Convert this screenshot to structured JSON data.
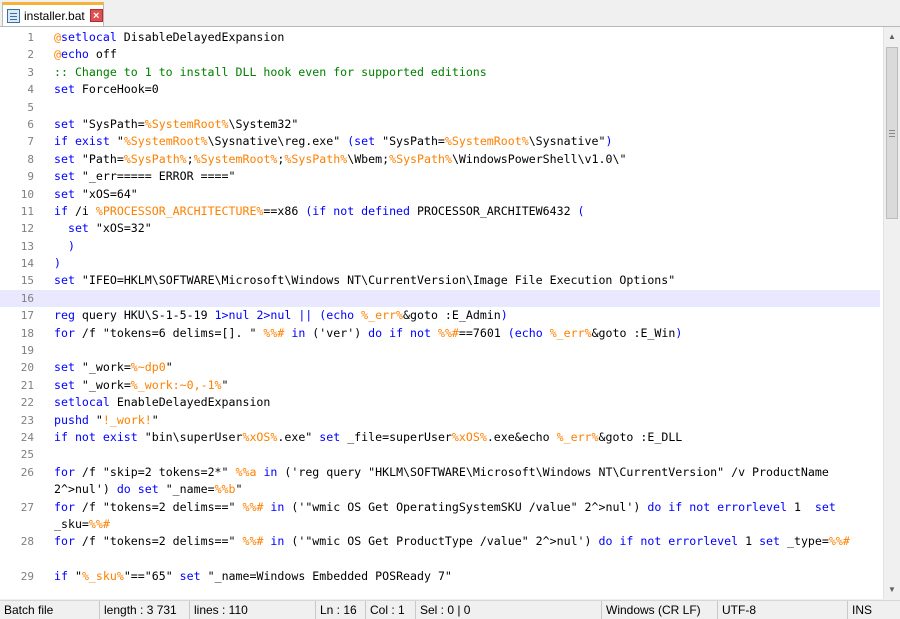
{
  "tab": {
    "title": "installer.bat"
  },
  "editor": {
    "current_line": 16,
    "lines": [
      {
        "n": "1",
        "html": "<span class=\"o\">@</span><span class=\"k\">setlocal</span> DisableDelayedExpansion"
      },
      {
        "n": "2",
        "html": "<span class=\"o\">@</span><span class=\"k\">echo</span> off"
      },
      {
        "n": "3",
        "html": "<span class=\"c\">:: Change to 1 to install DLL hook even for supported editions</span>"
      },
      {
        "n": "4",
        "html": "<span class=\"k\">set</span> ForceHook=0"
      },
      {
        "n": "5",
        "html": ""
      },
      {
        "n": "6",
        "html": "<span class=\"k\">set</span> \"SysPath=<span class=\"v\">%SystemRoot%</span>\\System32\""
      },
      {
        "n": "7",
        "html": "<span class=\"k\">if exist</span> \"<span class=\"v\">%SystemRoot%</span>\\Sysnative\\reg.exe\" <span class=\"k\">(set</span> \"SysPath=<span class=\"v\">%SystemRoot%</span>\\Sysnative\"<span class=\"k\">)</span>"
      },
      {
        "n": "8",
        "html": "<span class=\"k\">set</span> \"Path=<span class=\"v\">%SysPath%</span>;<span class=\"v\">%SystemRoot%</span>;<span class=\"v\">%SysPath%</span>\\Wbem;<span class=\"v\">%SysPath%</span>\\WindowsPowerShell\\v1.0\\\""
      },
      {
        "n": "9",
        "html": "<span class=\"k\">set</span> \"_err===== ERROR ====\""
      },
      {
        "n": "10",
        "html": "<span class=\"k\">set</span> \"xOS=64\""
      },
      {
        "n": "11",
        "html": "<span class=\"k\">if</span> /i <span class=\"v\">%PROCESSOR_ARCHITECTURE%</span>==x86 <span class=\"k\">(if not defined</span> PROCESSOR_ARCHITEW6432 <span class=\"k\">(</span>"
      },
      {
        "n": "12",
        "html": "  <span class=\"k\">set</span> \"xOS=32\""
      },
      {
        "n": "13",
        "html": "  <span class=\"k\">)</span>"
      },
      {
        "n": "14",
        "html": "<span class=\"k\">)</span>"
      },
      {
        "n": "15",
        "html": "<span class=\"k\">set</span> \"IFEO=HKLM\\SOFTWARE\\Microsoft\\Windows NT\\CurrentVersion\\Image File Execution Options\""
      },
      {
        "n": "16",
        "html": ""
      },
      {
        "n": "17",
        "html": "<span class=\"k\">reg</span> query HKU\\S-1-5-19 <span class=\"k\">1&gt;nul 2&gt;nul || (echo</span> <span class=\"v\">%_err%</span>&amp;goto :E_Admin<span class=\"k\">)</span>"
      },
      {
        "n": "18",
        "html": "<span class=\"k\">for</span> /f \"tokens=6 delims=[]. \" <span class=\"v\">%%#</span> <span class=\"k\">in</span> ('ver') <span class=\"k\">do if not</span> <span class=\"v\">%%#</span>==7601 <span class=\"k\">(echo</span> <span class=\"v\">%_err%</span>&amp;goto :E_Win<span class=\"k\">)</span>"
      },
      {
        "n": "19",
        "html": ""
      },
      {
        "n": "20",
        "html": "<span class=\"k\">set</span> \"_work=<span class=\"v\">%~dp0</span>\""
      },
      {
        "n": "21",
        "html": "<span class=\"k\">set</span> \"_work=<span class=\"v\">%_work:~0,-1%</span>\""
      },
      {
        "n": "22",
        "html": "<span class=\"k\">setlocal</span> EnableDelayedExpansion"
      },
      {
        "n": "23",
        "html": "<span class=\"k\">pushd</span> \"<span class=\"v\">!_work!</span>\""
      },
      {
        "n": "24",
        "html": "<span class=\"k\">if not exist</span> \"bin\\superUser<span class=\"v\">%xOS%</span>.exe\" <span class=\"k\">set</span> _file=superUser<span class=\"v\">%xOS%</span>.exe&amp;echo <span class=\"v\">%_err%</span>&amp;goto :E_DLL"
      },
      {
        "n": "25",
        "html": ""
      },
      {
        "n": "26",
        "tall": true,
        "html": "<span class=\"k\">for</span> /f \"skip=2 tokens=2*\" <span class=\"v\">%%a</span> <span class=\"k\">in</span> ('reg query \"HKLM\\SOFTWARE\\Microsoft\\Windows NT\\CurrentVersion\" /v ProductName 2^&gt;nul') <span class=\"k\">do set</span> \"_name=<span class=\"v\">%%b</span>\""
      },
      {
        "n": "27",
        "tall": true,
        "html": "<span class=\"k\">for</span> /f \"tokens=2 delims==\" <span class=\"v\">%%#</span> <span class=\"k\">in</span> ('\"wmic OS Get OperatingSystemSKU /value\" 2^&gt;nul') <span class=\"k\">do if not errorlevel</span> 1  <span class=\"k\">set</span> _sku=<span class=\"v\">%%#</span>"
      },
      {
        "n": "28",
        "tall": true,
        "html": "<span class=\"k\">for</span> /f \"tokens=2 delims==\" <span class=\"v\">%%#</span> <span class=\"k\">in</span> ('\"wmic OS Get ProductType /value\" 2^&gt;nul') <span class=\"k\">do if not errorlevel</span> 1 <span class=\"k\">set</span> _type=<span class=\"v\">%%#</span>"
      },
      {
        "n": "29",
        "html": "<span class=\"k\">if</span> \"<span class=\"v\">%_sku%</span>\"==\"65\" <span class=\"k\">set</span> \"_name=Windows Embedded POSReady 7\""
      }
    ]
  },
  "statusbar": {
    "file_type": "Batch file",
    "length": "length : 3 731",
    "lines": "lines : 110",
    "ln": "Ln : 16",
    "col": "Col : 1",
    "sel": "Sel : 0 | 0",
    "eol": "Windows (CR LF)",
    "encoding": "UTF-8",
    "mode": "INS"
  },
  "icons": [
    "file-icon",
    "close-tab-icon",
    "scroll-up-icon",
    "scroll-down-icon"
  ]
}
